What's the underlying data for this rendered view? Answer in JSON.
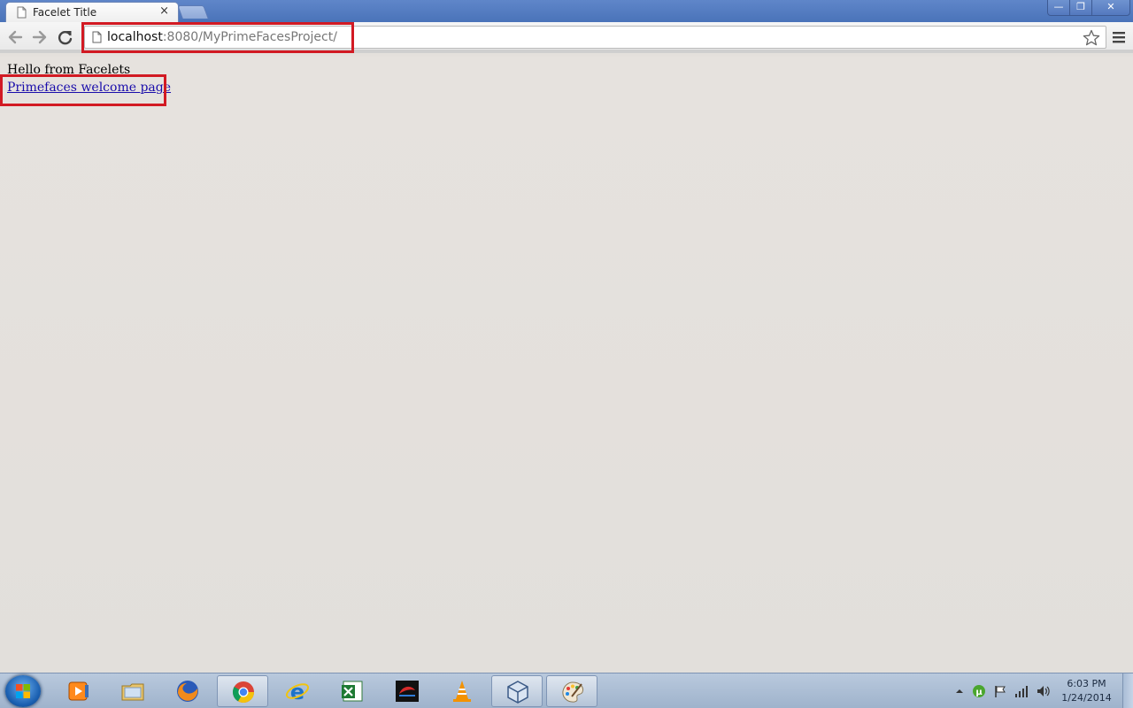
{
  "browser": {
    "tab_title": "Facelet Title",
    "tab_close": "×",
    "address_host": "localhost",
    "address_rest": ":8080/MyPrimeFacesProject/",
    "window_controls": {
      "minimize": "—",
      "maximize": "❐",
      "close": "✕"
    }
  },
  "page": {
    "heading_text": "Hello from Facelets",
    "link_text": "Primefaces welcome page"
  },
  "annotations": {
    "color": "#d21a23"
  },
  "taskbar": {
    "apps": [
      "media-player",
      "file-explorer",
      "firefox",
      "chrome",
      "internet-explorer",
      "excel",
      "app-dark",
      "vlc",
      "virtualbox",
      "paint"
    ],
    "clock_time": "6:03 PM",
    "clock_date": "1/24/2014"
  }
}
